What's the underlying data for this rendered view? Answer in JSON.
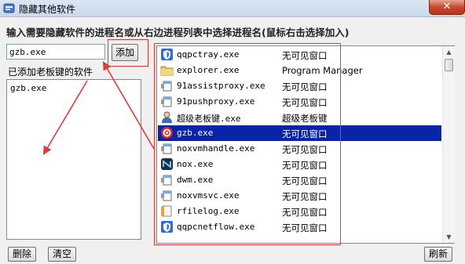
{
  "window": {
    "title": "隐藏其他软件",
    "close_label": "✕"
  },
  "instruction": "输入需要隐藏软件的进程名或从右边进程列表中选择进程名(鼠标右击选择加入)",
  "name_input": {
    "value": "gzb.exe"
  },
  "add_button": "添加",
  "added_label": "已添加老板键的软件",
  "added_list": [
    "gzb.exe"
  ],
  "processes": [
    {
      "name": "qqpctray.exe",
      "window": "无可见窗口",
      "icon": "shield-icon",
      "selected": false
    },
    {
      "name": "explorer.exe",
      "window": "Program Manager",
      "icon": "folder-icon",
      "selected": false
    },
    {
      "name": "91assistproxy.exe",
      "window": "无可见窗口",
      "icon": "window-icon",
      "selected": false
    },
    {
      "name": "91pushproxy.exe",
      "window": "无可见窗口",
      "icon": "window-icon",
      "selected": false
    },
    {
      "name": "超级老板键.exe",
      "window": "超级老板键",
      "icon": "user-icon",
      "selected": false
    },
    {
      "name": "gzb.exe",
      "window": "无可见窗口",
      "icon": "gzb-icon",
      "selected": true
    },
    {
      "name": "noxvmhandle.exe",
      "window": "无可见窗口",
      "icon": "window-icon",
      "selected": false
    },
    {
      "name": "nox.exe",
      "window": "无可见窗口",
      "icon": "nox-icon",
      "selected": false
    },
    {
      "name": "dwm.exe",
      "window": "无可见窗口",
      "icon": "window-icon",
      "selected": false
    },
    {
      "name": "noxvmsvc.exe",
      "window": "无可见窗口",
      "icon": "window-icon",
      "selected": false
    },
    {
      "name": "rfilelog.exe",
      "window": "无可见窗口",
      "icon": "file-icon",
      "selected": false
    },
    {
      "name": "qqpcnetflow.exe",
      "window": "无可见窗口",
      "icon": "shield-icon",
      "selected": false
    }
  ],
  "buttons": {
    "delete": "删除",
    "clear": "清空",
    "refresh": "刷新"
  },
  "colors": {
    "selection": "#0a24a8",
    "annotation": "#e03a3a"
  }
}
